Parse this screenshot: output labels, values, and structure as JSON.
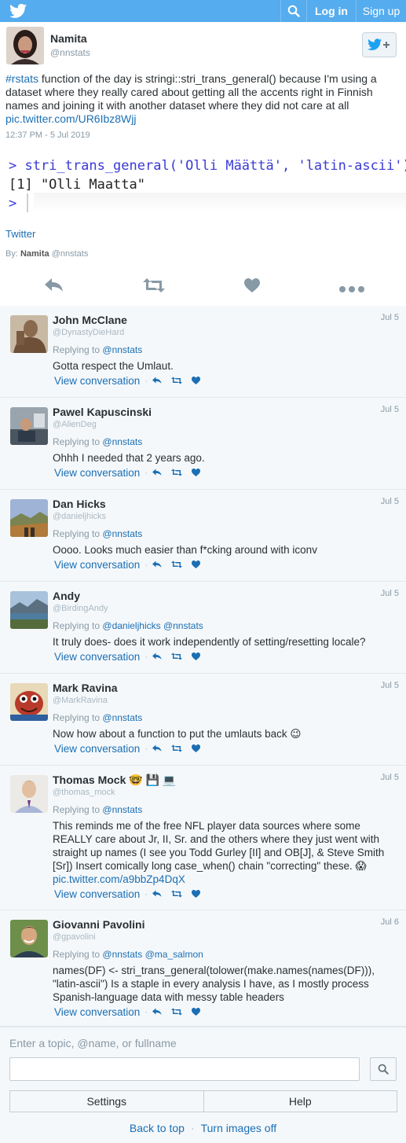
{
  "header": {
    "logo_icon": "twitter-bird-icon",
    "search_icon": "search-icon",
    "login_label": "Log in",
    "signup_label": "Sign up",
    "brand_color": "#55acee"
  },
  "main_tweet": {
    "name": "Namita",
    "handle": "@nnstats",
    "follow_icon": "follow-bird-plus-icon",
    "hashtag": "#rstats",
    "text": " function of the day is stringi::stri_trans_general() because I'm using a dataset where they really cared about getting all the accents right in Finnish names and joining it with another dataset where they did not care at all ",
    "link": "pic.twitter.com/UR6Ibz8Wjj",
    "timestamp": "12:37 PM - 5 Jul 2019",
    "code_lines": [
      "> stri_trans_general('Olli Määttä', 'latin-ascii')",
      "[1] \"Olli Maatta\"",
      ">"
    ],
    "source": "Twitter",
    "by_label": "By:",
    "by_name": "Namita",
    "by_handle": "@nnstats",
    "actions": [
      "reply-icon",
      "retweet-icon",
      "like-icon",
      "more-icon"
    ]
  },
  "replies": [
    {
      "name": "John McClane",
      "handle": "@DynastyDieHard",
      "date": "Jul 5",
      "replying_label": "Replying to",
      "replying_to": "@nnstats",
      "text": "Gotta respect the Umlaut.",
      "view_label": "View conversation",
      "avatar_color": "#8a6a4e"
    },
    {
      "name": "Pawel Kapuscinski",
      "handle": "@AlienDeg",
      "date": "Jul 5",
      "replying_label": "Replying to",
      "replying_to": "@nnstats",
      "text": "Ohhh I needed that 2 years ago.",
      "view_label": "View conversation",
      "avatar_color": "#6b7480"
    },
    {
      "name": "Dan Hicks",
      "handle": "@danieljhicks",
      "date": "Jul 5",
      "replying_label": "Replying to",
      "replying_to": "@nnstats",
      "text": "Oooo. Looks much easier than f*cking around with iconv",
      "view_label": "View conversation",
      "avatar_color": "#7f8fb0"
    },
    {
      "name": "Andy",
      "handle": "@BirdingAndy",
      "date": "Jul 5",
      "replying_label": "Replying to",
      "replying_to": "@danieljhicks @nnstats",
      "text": "It truly does- does it work independently of setting/resetting locale?",
      "view_label": "View conversation",
      "avatar_color": "#5a7f9e"
    },
    {
      "name": "Mark Ravina",
      "handle": "@MarkRavina",
      "date": "Jul 5",
      "replying_label": "Replying to",
      "replying_to": "@nnstats",
      "text": "Now how about a function to put the umlauts back 😉",
      "view_label": "View conversation",
      "avatar_color": "#b83a2a"
    },
    {
      "name": "Thomas Mock",
      "name_icons": "🤓 💾 💻",
      "handle": "@thomas_mock",
      "date": "Jul 5",
      "replying_label": "Replying to",
      "replying_to": "@nnstats",
      "text": "This reminds me of the free NFL player data sources where some REALLY care about Jr, II, Sr. and the others where they just went with straight up names (I see you Todd Gurley [II] and OB[J], & Steve Smith [Sr]) Insert comically long case_when() chain \"correcting\" these. 😱",
      "link": "pic.twitter.com/a9bbZp4DqX",
      "view_label": "View conversation",
      "avatar_color": "#c9b79a"
    },
    {
      "name": "Giovanni Pavolini",
      "handle": "@gpavolini",
      "date": "Jul 6",
      "replying_label": "Replying to",
      "replying_to": "@nnstats @ma_salmon",
      "text": "names(DF) <- stri_trans_general(tolower(make.names(names(DF))), \"latin-ascii\") Is a staple in every analysis I have, as I mostly process Spanish-language data with messy table headers",
      "view_label": "View conversation",
      "avatar_color": "#5c7a3e"
    }
  ],
  "footer": {
    "search_label": "Enter a topic, @name, or fullname",
    "search_value": "",
    "settings_label": "Settings",
    "help_label": "Help",
    "back_to_top": "Back to top",
    "turn_images_off": "Turn images off",
    "separator": "·"
  }
}
